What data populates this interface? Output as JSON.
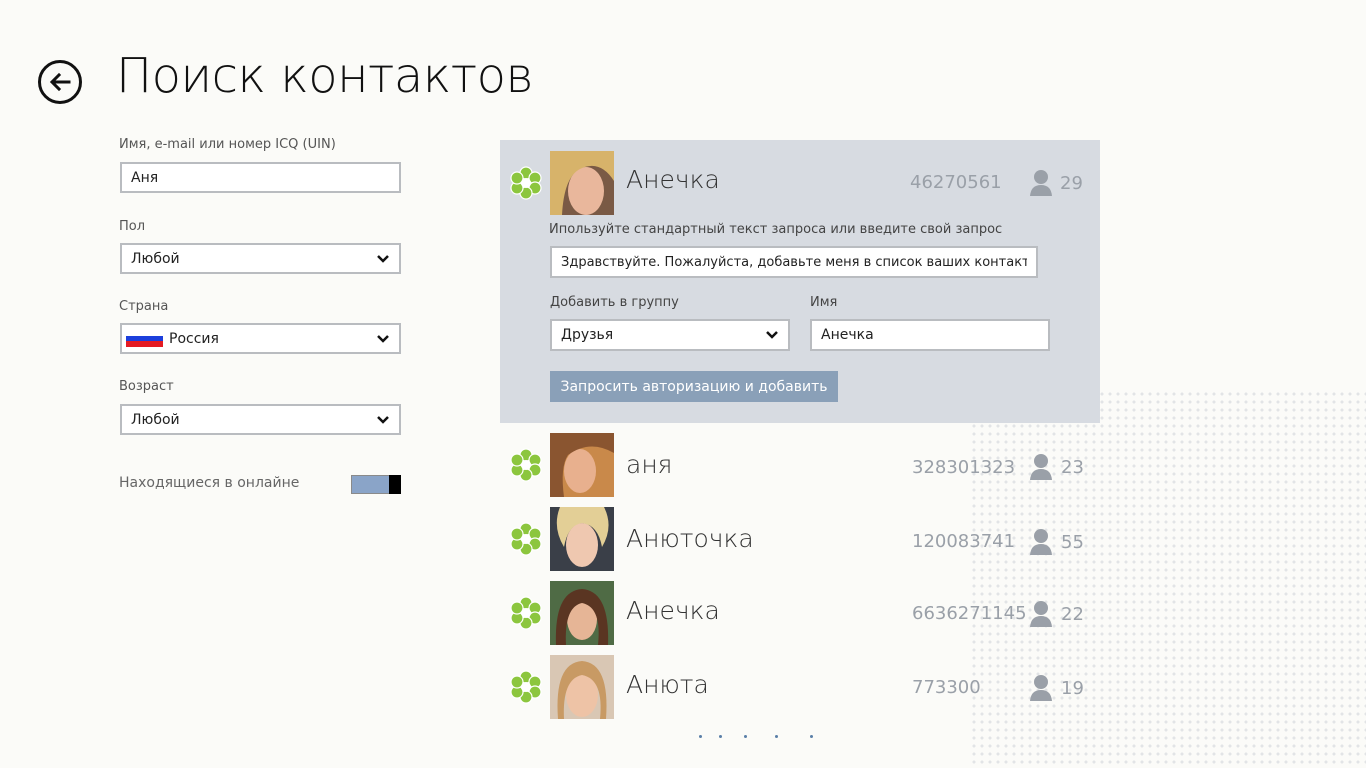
{
  "page": {
    "title": "Поиск контактов"
  },
  "search_form": {
    "query": {
      "label": "Имя, e-mail или номер ICQ (UIN)",
      "value": "Аня"
    },
    "gender": {
      "label": "Пол",
      "value": "Любой"
    },
    "country": {
      "label": "Страна",
      "value": "Россия"
    },
    "age": {
      "label": "Возраст",
      "value": "Любой"
    },
    "online_only": {
      "label": "Находящиеся в онлайне",
      "on": true
    }
  },
  "expanded": {
    "request_hint": "Ипользуйте стандартный текст запроса или введите свой запрос",
    "request_text": "Здравствуйте. Пожалуйста, добавьте меня в список ваших контактов.",
    "group_label": "Добавить в группу",
    "group_value": "Друзья",
    "name_label": "Имя",
    "name_value": "Анечка",
    "auth_button": "Запросить авторизацию и добавить"
  },
  "contacts": [
    {
      "name": "Анечка",
      "uin": "46270561",
      "age": "29"
    },
    {
      "name": "аня",
      "uin": "328301323",
      "age": "23"
    },
    {
      "name": "Анюточка",
      "uin": "120083741",
      "age": "55"
    },
    {
      "name": "Анечка",
      "uin": "6636271145",
      "age": "22"
    },
    {
      "name": "Анюта",
      "uin": "773300",
      "age": "19"
    }
  ],
  "colors": {
    "status_online": "#8cc63e",
    "button_blue": "#8aa0b8",
    "expanded_bg": "#d7dbe1"
  },
  "icons": {
    "back": "arrow-left-circle-icon",
    "status": "icq-flower-icon",
    "age": "person-silhouette-icon",
    "dropdown": "chevron-down-icon"
  }
}
